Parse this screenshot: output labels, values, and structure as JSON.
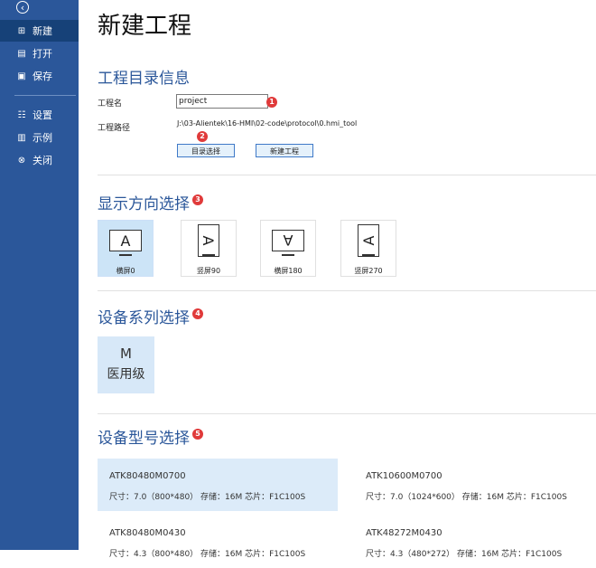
{
  "sidebar": {
    "back_icon": "‹",
    "items": [
      {
        "icon": "⊞",
        "label": "新建"
      },
      {
        "icon": "▤",
        "label": "打开"
      },
      {
        "icon": "▣",
        "label": "保存"
      },
      {
        "icon": "☷",
        "label": "设置"
      },
      {
        "icon": "▥",
        "label": "示例"
      },
      {
        "icon": "⊗",
        "label": "关闭"
      }
    ],
    "bg_color": "#2b579a",
    "active_color": "#164178"
  },
  "page_title": "新建工程",
  "project_section": {
    "title": "工程目录信息",
    "name_label": "工程名",
    "name_value": "project",
    "path_label": "工程路径",
    "path_value": "J:\\03-Alientek\\16-HMI\\02-code\\protocol\\0.hmi_tool",
    "dir_button": "目录选择",
    "new_button": "新建工程",
    "badge1": "1",
    "badge2": "2"
  },
  "orientation_section": {
    "title": "显示方向选择",
    "badge": "3",
    "options": [
      {
        "glyph": "A",
        "label": "横屏0"
      },
      {
        "glyph": "A",
        "label": "竖屏90"
      },
      {
        "glyph": "A",
        "label": "横屏180"
      },
      {
        "glyph": "A",
        "label": "竖屏270"
      }
    ]
  },
  "series_section": {
    "title": "设备系列选择",
    "badge": "4",
    "card": {
      "letter": "M",
      "name": "医用级"
    }
  },
  "model_section": {
    "title": "设备型号选择",
    "badge": "5",
    "models": [
      {
        "name": "ATK80480M0700",
        "spec": "尺寸：7.0（800*480）  存储：16M 芯片：F1C100S"
      },
      {
        "name": "ATK10600M0700",
        "spec": "尺寸：7.0（1024*600）  存储：16M 芯片：F1C100S"
      },
      {
        "name": "ATK80480M0430",
        "spec": "尺寸：4.3（800*480）  存储：16M 芯片：F1C100S"
      },
      {
        "name": "ATK48272M0430",
        "spec": "尺寸：4.3（480*272）  存储：16M 芯片：F1C100S"
      }
    ]
  }
}
